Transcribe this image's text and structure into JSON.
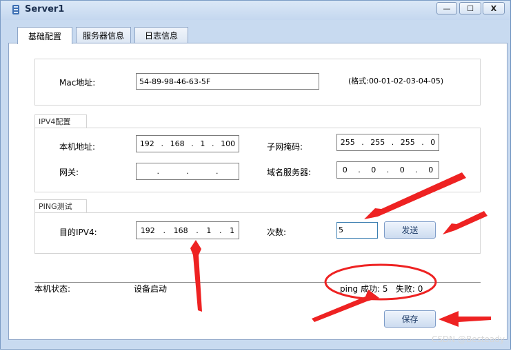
{
  "window": {
    "title": "Server1",
    "minimize": "—",
    "maximize": "☐",
    "close": "X"
  },
  "tabs": [
    {
      "label": "基础配置"
    },
    {
      "label": "服务器信息"
    },
    {
      "label": "日志信息"
    }
  ],
  "mac": {
    "label": "Mac地址:",
    "value": "54-89-98-46-63-5F",
    "hint": "(格式:00-01-02-03-04-05)"
  },
  "ipv4": {
    "section_title": "IPV4配置",
    "local_label": "本机地址:",
    "local_ip": [
      "192",
      "168",
      "1",
      "100"
    ],
    "mask_label": "子网掩码:",
    "mask": [
      "255",
      "255",
      "255",
      "0"
    ],
    "gateway_label": "网关:",
    "gateway": [
      "",
      "",
      "",
      ""
    ],
    "dns_label": "域名服务器:",
    "dns": [
      "0",
      "0",
      "0",
      "0"
    ]
  },
  "ping": {
    "section_title": "PING测试",
    "dest_label": "目的IPV4:",
    "dest_ip": [
      "192",
      "168",
      "1",
      "1"
    ],
    "count_label": "次数:",
    "count_value": "5",
    "send_button": "发送"
  },
  "status": {
    "label": "本机状态:",
    "value": "设备启动",
    "ping_result": "ping 成功: 5   失败: 0"
  },
  "save_button": "保存",
  "watermark": "CSDN @Besteady",
  "colors": {
    "annotation_red": "#ee2222",
    "title_bar": "#c4d7ef"
  }
}
